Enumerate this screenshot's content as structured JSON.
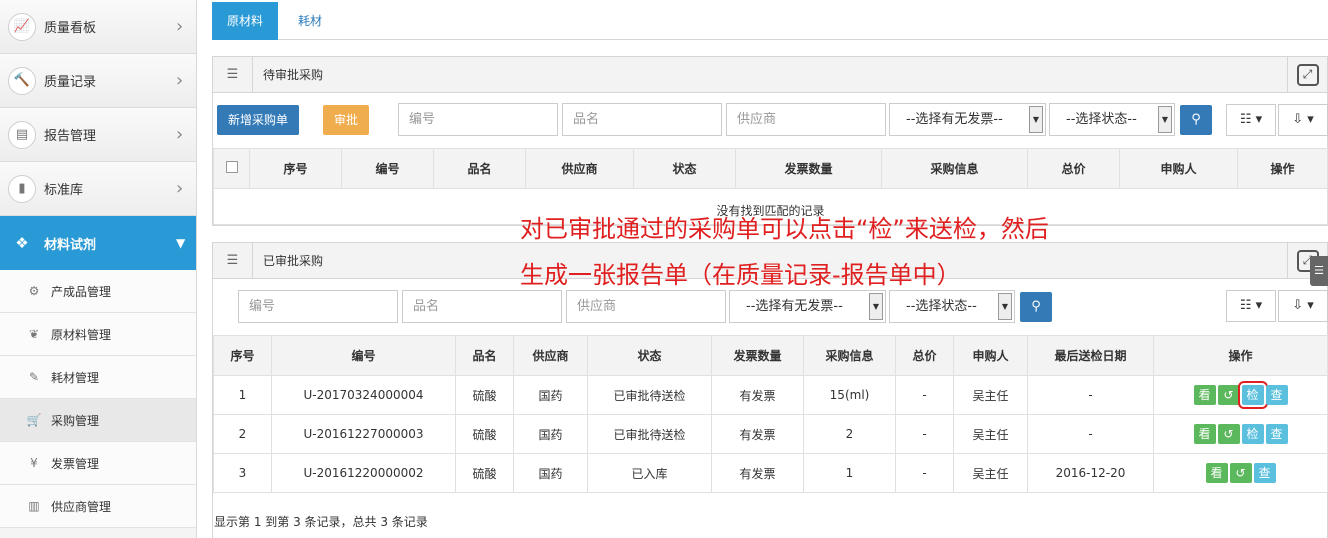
{
  "sidebar": {
    "top_items": [
      {
        "label": "质量看板",
        "icon": "chart-line-icon"
      },
      {
        "label": "质量记录",
        "icon": "gavel-icon"
      },
      {
        "label": "报告管理",
        "icon": "document-icon"
      },
      {
        "label": "标准库",
        "icon": "book-icon"
      }
    ],
    "active": {
      "label": "材料试剂",
      "icon": "cubes-icon"
    },
    "sub_items": [
      {
        "label": "产成品管理",
        "icon": "gear-icon"
      },
      {
        "label": "原材料管理",
        "icon": "leaf-icon"
      },
      {
        "label": "耗材管理",
        "icon": "wrench-icon"
      },
      {
        "label": "采购管理",
        "icon": "cart-icon"
      },
      {
        "label": "发票管理",
        "icon": "yen-icon"
      },
      {
        "label": "供应商管理",
        "icon": "building-icon"
      }
    ]
  },
  "tabs": {
    "materials": "原材料",
    "consumables": "耗材"
  },
  "pending": {
    "title": "待审批采购",
    "new_button": "新增采购单",
    "approve_button": "审批",
    "placeholder_code": "编号",
    "placeholder_name": "品名",
    "placeholder_supplier": "供应商",
    "invoice_select": "--选择有无发票--",
    "status_select": "--选择状态--",
    "columns": [
      "序号",
      "编号",
      "品名",
      "供应商",
      "状态",
      "发票数量",
      "采购信息",
      "总价",
      "申购人",
      "操作"
    ],
    "empty": "没有找到匹配的记录"
  },
  "approved": {
    "title": "已审批采购",
    "placeholder_code": "编号",
    "placeholder_name": "品名",
    "placeholder_supplier": "供应商",
    "invoice_select": "--选择有无发票--",
    "status_select": "--选择状态--",
    "columns": [
      "序号",
      "编号",
      "品名",
      "供应商",
      "状态",
      "发票数量",
      "采购信息",
      "总价",
      "申购人",
      "最后送检日期",
      "操作"
    ],
    "rows": [
      [
        "1",
        "U-20170324000004",
        "硫酸",
        "国药",
        "已审批待送检",
        "有发票",
        "15(ml)",
        "-",
        "吴主任",
        "-"
      ],
      [
        "2",
        "U-20161227000003",
        "硫酸",
        "国药",
        "已审批待送检",
        "有发票",
        "2",
        "-",
        "吴主任",
        "-"
      ],
      [
        "3",
        "U-20161220000002",
        "硫酸",
        "国药",
        "已入库",
        "有发票",
        "1",
        "-",
        "吴主任",
        "2016-12-20"
      ]
    ],
    "actions": {
      "view": "看",
      "send": "检",
      "check": "查"
    },
    "footer": "显示第 1 到第 3 条记录，总共 3 条记录"
  },
  "annotation": {
    "line1": "对已审批通过的采购单可以点击“检”来送检，然后",
    "line2": "生成一张报告单（在质量记录-报告单中）"
  },
  "colors": {
    "accent": "#2a9ad6",
    "primary": "#337ab7",
    "warning": "#f0ad4e",
    "success": "#5cb85c",
    "info": "#5bc0de",
    "annotation": "#e02020"
  }
}
